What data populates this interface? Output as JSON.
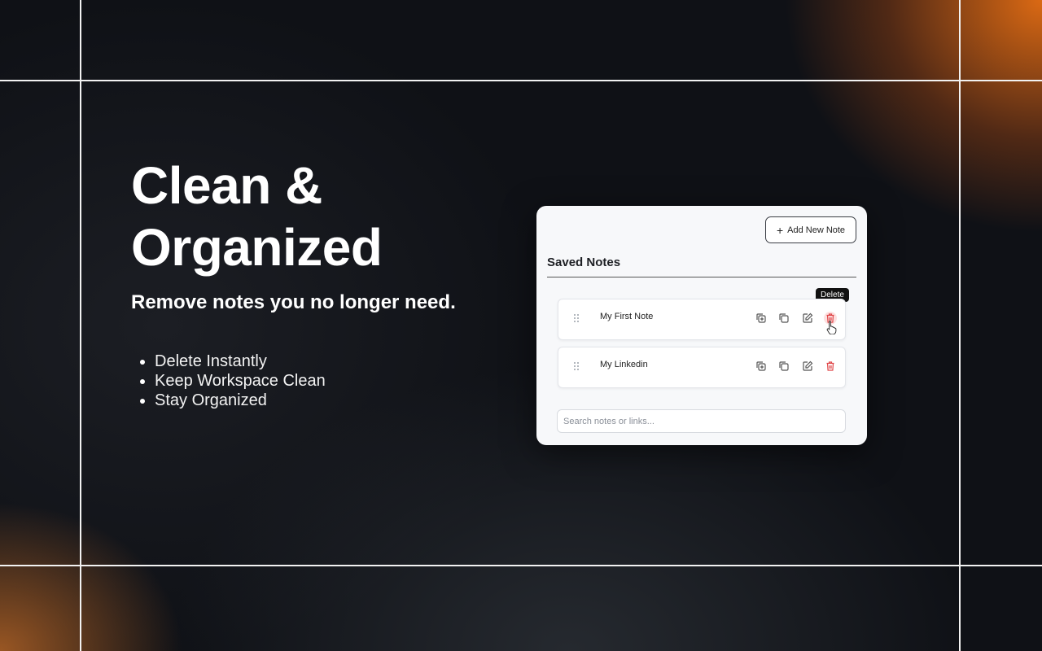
{
  "hero": {
    "title": "Clean & Organized",
    "subtitle": "Remove notes you no longer need.",
    "features": [
      "Delete Instantly",
      "Keep Workspace Clean",
      "Stay Organized"
    ]
  },
  "panel": {
    "add_button_label": "Add New Note",
    "section_title": "Saved Notes",
    "tooltip": "Delete",
    "notes": [
      {
        "title": "My First Note"
      },
      {
        "title": "My Linkedin"
      }
    ],
    "search_placeholder": "Search notes or links..."
  },
  "colors": {
    "background": "#0f1116",
    "accent_orange": "#e06e14",
    "delete_red": "#e0484a",
    "panel_bg": "#f7f8fa"
  },
  "icons": [
    "plus-icon",
    "drag-handle-icon",
    "add-copy-icon",
    "copy-icon",
    "edit-icon",
    "trash-icon",
    "pointer-cursor-icon"
  ]
}
